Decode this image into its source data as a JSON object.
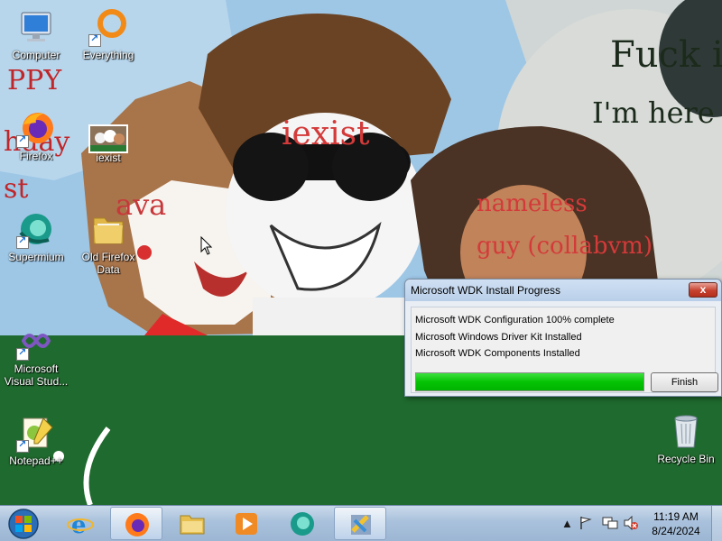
{
  "wallpaper": {
    "labels": {
      "iexist": "iexist",
      "ava": "ava",
      "nameless": "nameless",
      "guy": "guy (collabvm)",
      "fuck": "Fuck it,",
      "here": "I'm here to",
      "ppy": "PPY",
      "hday": "hday",
      "st": "st"
    }
  },
  "desktop": {
    "icons": {
      "computer": "Computer",
      "everything": "Everything",
      "firefox": "Firefox",
      "iexist": "iexist",
      "supermium": "Supermium",
      "old_firefox": "Old Firefox Data",
      "visual_studio": "Microsoft Visual Stud...",
      "notepadpp": "Notepad++",
      "recycle_bin": "Recycle Bin"
    }
  },
  "dialog": {
    "title": "Microsoft WDK Install Progress",
    "close_label": "x",
    "lines": [
      "Microsoft WDK Configuration  100% complete",
      "Microsoft Windows Driver Kit Installed",
      "Microsoft WDK Components Installed"
    ],
    "progress_percent": 100,
    "progress_color": "#00c000",
    "finish_label": "Finish"
  },
  "taskbar": {
    "apps": [
      "start",
      "internet-explorer",
      "firefox",
      "explorer",
      "media-player",
      "supermium",
      "wdk-setup"
    ],
    "clock_time": "11:19 AM",
    "clock_date": "8/24/2024"
  }
}
